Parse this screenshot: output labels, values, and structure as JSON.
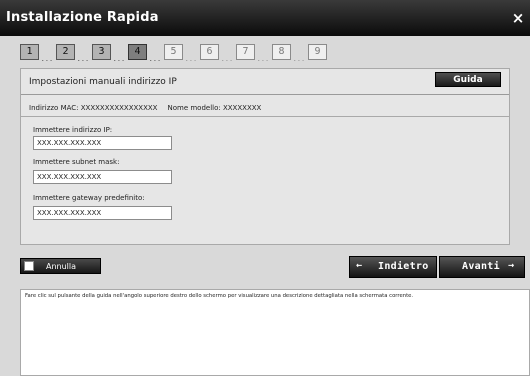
{
  "window": {
    "title": "Installazione Rapida",
    "close_glyph": "×"
  },
  "steps": [
    {
      "number": "1",
      "state": "done"
    },
    {
      "number": "2",
      "state": "done"
    },
    {
      "number": "3",
      "state": "done"
    },
    {
      "number": "4",
      "state": "current"
    },
    {
      "number": "5",
      "state": "pending"
    },
    {
      "number": "6",
      "state": "pending"
    },
    {
      "number": "7",
      "state": "pending"
    },
    {
      "number": "8",
      "state": "pending"
    },
    {
      "number": "9",
      "state": "pending"
    }
  ],
  "step_suffix": "...",
  "panel": {
    "title": "Impostazioni manuali indirizzo IP",
    "help_label": "Guida",
    "mac": "Indirizzo MAC: XXXXXXXXXXXXXXXX",
    "model": "Nome modello: XXXXXXXX"
  },
  "fields": {
    "ip": {
      "label": "Immettere indirizzo IP:",
      "value": "XXX.XXX.XXX.XXX"
    },
    "mask": {
      "label": "Immettere subnet mask:",
      "value": "XXX.XXX.XXX.XXX"
    },
    "gateway": {
      "label": "Immettere gateway predefinito:",
      "value": "XXX.XXX.XXX.XXX"
    }
  },
  "buttons": {
    "cancel": "Annulla",
    "back": "Indietro",
    "next": "Avanti",
    "back_arrow": "←",
    "next_arrow": "→"
  },
  "description": "Fare clic sul pulsante della guida nell'angolo superiore destro dello schermo per visualizzare una descrizione dettagliata nella schermata corrente.",
  "icons": {
    "close": "close-icon",
    "back": "arrow-left-icon",
    "next": "arrow-right-icon"
  },
  "colors": {
    "title_bar": "#111111",
    "button_dark": "#222222",
    "step_current": "#7e7e7e",
    "step_done": "#b3b3b3"
  }
}
